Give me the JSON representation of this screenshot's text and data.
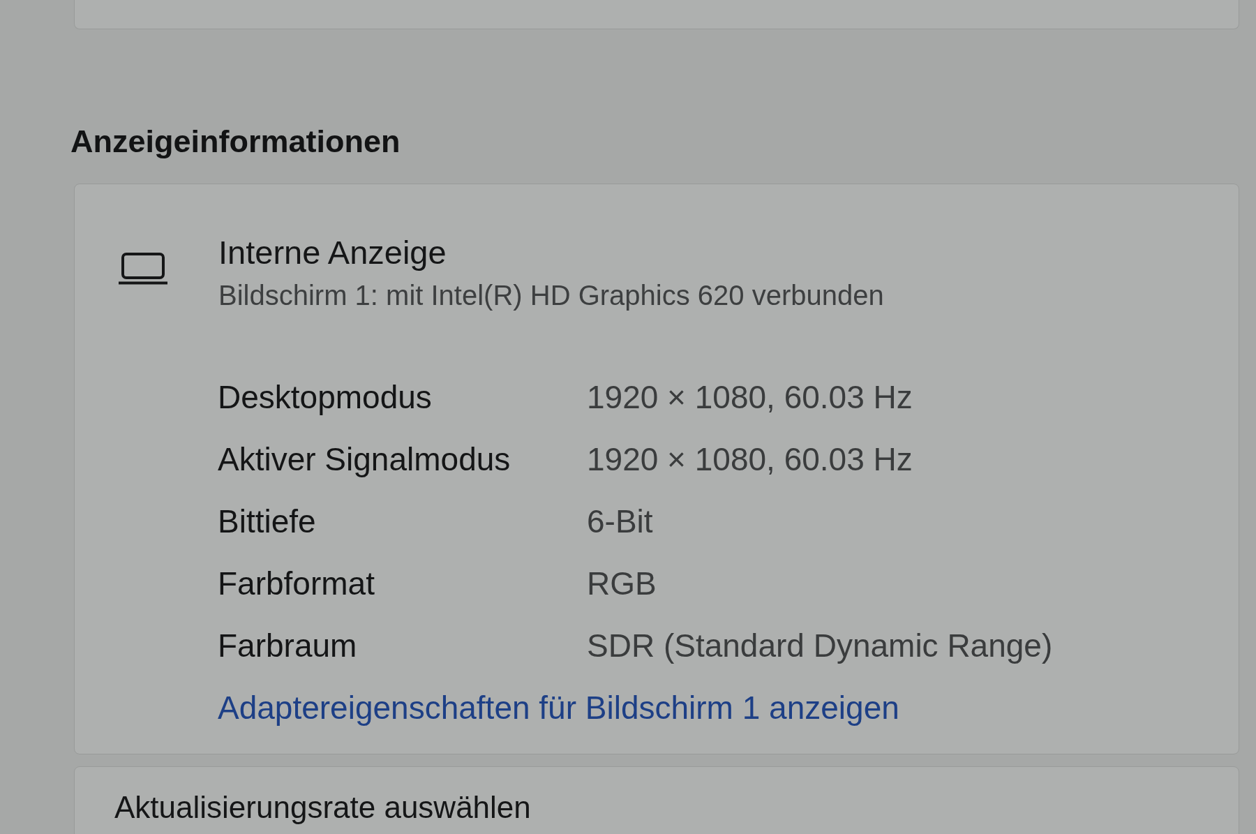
{
  "section": {
    "title": "Anzeigeinformationen"
  },
  "display": {
    "name": "Interne Anzeige",
    "description": "Bildschirm 1: mit Intel(R) HD Graphics 620 verbunden"
  },
  "properties": [
    {
      "label": "Desktopmodus",
      "value": "1920 × 1080, 60.03 Hz"
    },
    {
      "label": "Aktiver Signalmodus",
      "value": "1920 × 1080, 60.03 Hz"
    },
    {
      "label": "Bittiefe",
      "value": "6-Bit"
    },
    {
      "label": "Farbformat",
      "value": "RGB"
    },
    {
      "label": "Farbraum",
      "value": "SDR (Standard Dynamic Range)"
    }
  ],
  "link": "Adaptereigenschaften für Bildschirm 1 anzeigen",
  "next_card": {
    "title": "Aktualisierungsrate auswählen"
  }
}
